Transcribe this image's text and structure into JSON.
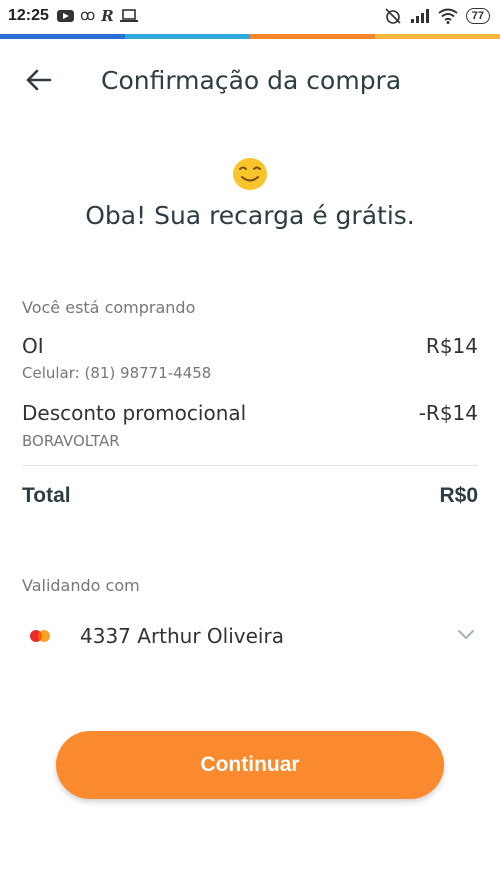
{
  "status_bar": {
    "time": "12:25",
    "battery": "77",
    "colors": [
      "#2a6fd6",
      "#2fa8e0",
      "#f7852b",
      "#f6b73c"
    ]
  },
  "header": {
    "title": "Confirmação da compra"
  },
  "hero": {
    "message": "Oba! Sua recarga é grátis.",
    "emoji": "smiling-face-icon"
  },
  "purchase": {
    "section_label": "Você está comprando",
    "item_name": "OI",
    "item_value": "R$14",
    "item_detail": "Celular: (81) 98771-4458",
    "discount_name": "Desconto promocional",
    "discount_value": "-R$14",
    "discount_code": "BORAVOLTAR",
    "total_label": "Total",
    "total_value": "R$0"
  },
  "payment": {
    "section_label": "Validando com",
    "card_text": "4337 Arthur Oliveira"
  },
  "actions": {
    "continue_label": "Continuar",
    "accent": "#fb8a2e"
  }
}
